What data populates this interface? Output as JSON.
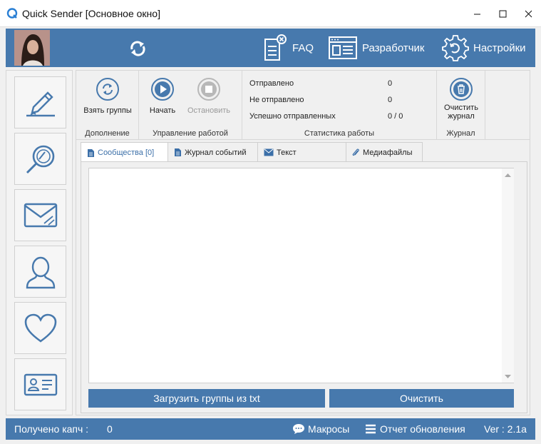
{
  "window": {
    "title": "Quick Sender [Основное окно]",
    "controls": {
      "minimize": "−",
      "maximize": "☐",
      "close": "✕"
    }
  },
  "banner": {
    "faq_label": "FAQ",
    "developer_label": "Разработчик",
    "settings_label": "Настройки"
  },
  "sidebar": {
    "items": [
      {
        "name": "edit",
        "icon": "pen-icon"
      },
      {
        "name": "search",
        "icon": "search-icon"
      },
      {
        "name": "messages",
        "icon": "envelope-icon"
      },
      {
        "name": "profile",
        "icon": "person-icon"
      },
      {
        "name": "likes",
        "icon": "heart-icon"
      },
      {
        "name": "contacts",
        "icon": "id-card-icon"
      }
    ]
  },
  "ribbon": {
    "groups": {
      "addition": {
        "label": "Дополнение",
        "take_groups": "Взять группы"
      },
      "control": {
        "label": "Управление работой",
        "start": "Начать",
        "stop": "Остановить"
      },
      "stats": {
        "label": "Статистика работы",
        "sent_label": "Отправлено",
        "sent_value": "0",
        "not_sent_label": "Не отправлено",
        "not_sent_value": "0",
        "success_label": "Успешно отправленных",
        "success_value": "0 / 0"
      },
      "journal": {
        "label": "Журнал",
        "clear_line1": "Очистить",
        "clear_line2": "журнал"
      }
    }
  },
  "tabs": [
    {
      "label": "Сообщества [0]",
      "active": true
    },
    {
      "label": "Журнал событий",
      "active": false
    },
    {
      "label": "Текст",
      "active": false
    },
    {
      "label": "Медиафайлы",
      "active": false
    }
  ],
  "panel": {
    "textarea_value": "",
    "load_button": "Загрузить группы из txt",
    "clear_button": "Очистить"
  },
  "status": {
    "captcha_label": "Получено капч :",
    "captcha_value": "0",
    "macros": "Макросы",
    "update_report": "Отчет обновления",
    "version": "Ver : 2.1a"
  },
  "colors": {
    "accent": "#4779ad",
    "active_tab_text": "#3b6fa8"
  }
}
